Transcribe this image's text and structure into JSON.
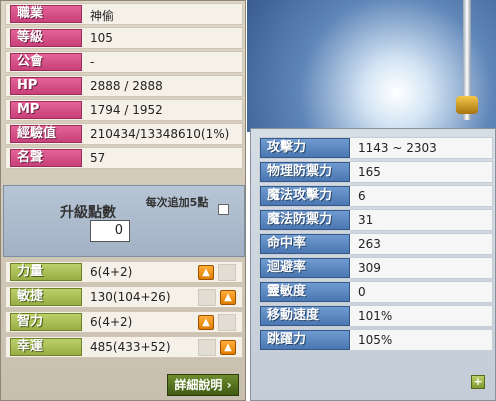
{
  "info": [
    {
      "label": "職業",
      "value": "神偷"
    },
    {
      "label": "等級",
      "value": "105"
    },
    {
      "label": "公會",
      "value": "-"
    },
    {
      "label": "HP",
      "value": "2888 / 2888"
    },
    {
      "label": "MP",
      "value": "1794 / 1952"
    },
    {
      "label": "經驗值",
      "value": "210434/13348610(1%)"
    },
    {
      "label": "名聲",
      "value": "57"
    }
  ],
  "ap": {
    "title": "升級點數",
    "hint": "每次追加5點",
    "value": "0"
  },
  "stats": [
    {
      "label": "力量",
      "value": "6(4+2)"
    },
    {
      "label": "敏捷",
      "value": "130(104+26)"
    },
    {
      "label": "智力",
      "value": "6(4+2)"
    },
    {
      "label": "幸運",
      "value": "485(433+52)"
    }
  ],
  "icons": {
    "up": "▲",
    "expand": "+",
    "arrow": "›"
  },
  "detail_button": "詳細說明",
  "combat": [
    {
      "label": "攻擊力",
      "value": "1143 ~ 2303"
    },
    {
      "label": "物理防禦力",
      "value": "165"
    },
    {
      "label": "魔法攻擊力",
      "value": "6"
    },
    {
      "label": "魔法防禦力",
      "value": "31"
    },
    {
      "label": "命中率",
      "value": "263"
    },
    {
      "label": "迴避率",
      "value": "309"
    },
    {
      "label": "靈敏度",
      "value": "0"
    },
    {
      "label": "移動速度",
      "value": "101%"
    },
    {
      "label": "跳躍力",
      "value": "105%"
    }
  ],
  "colors": {
    "info_label": "#d4508a",
    "stat_label": "#a9bd52",
    "combat_label": "#5a86c0",
    "up_button": "#f08c10"
  }
}
